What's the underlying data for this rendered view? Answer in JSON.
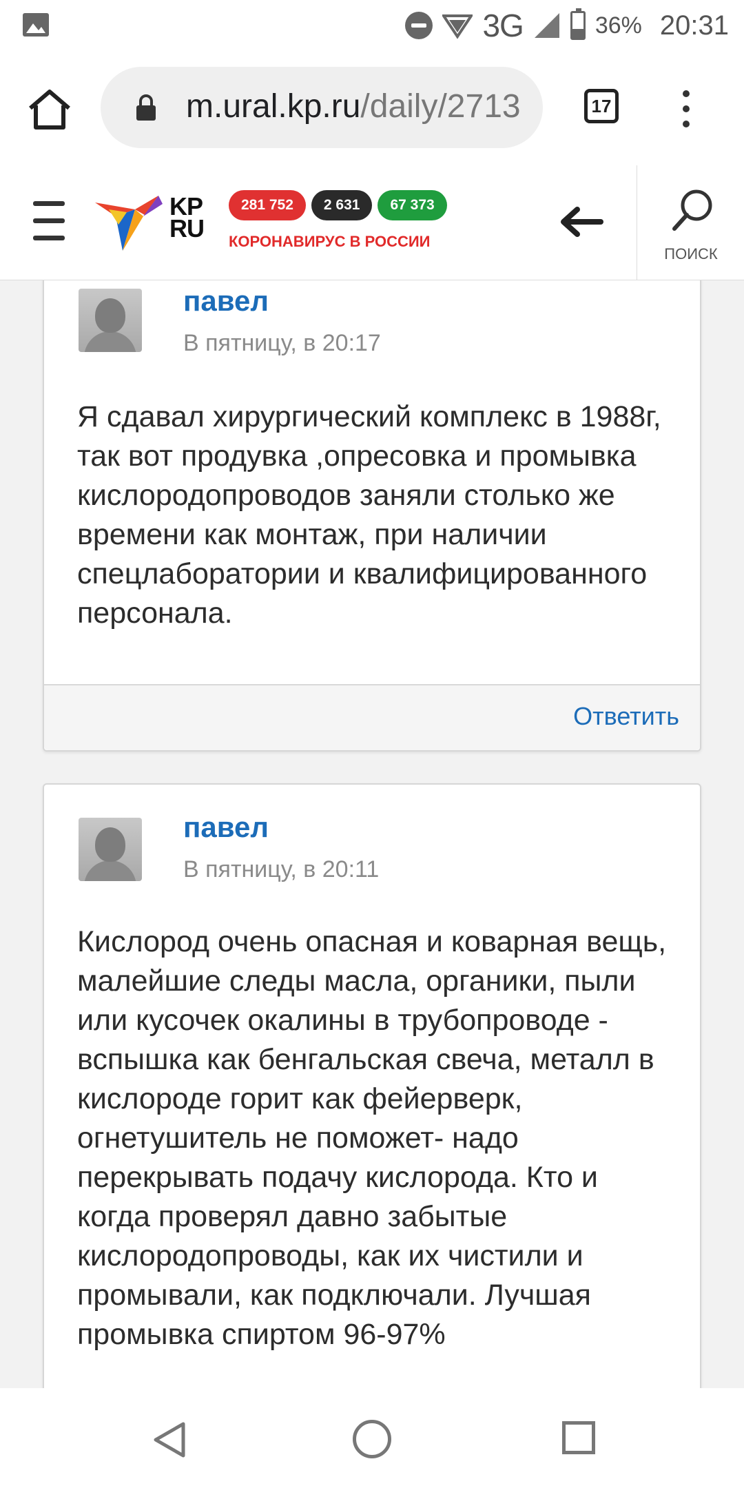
{
  "status_bar": {
    "network": "3G",
    "battery_percent": "36%",
    "battery_level": 0.36,
    "time": "20:31"
  },
  "browser": {
    "url_host": "m.ural.kp.ru",
    "url_path": "/daily/2713",
    "tab_count": "17"
  },
  "site_header": {
    "logo_text_top": "KP",
    "logo_text_bottom": "RU",
    "stats": {
      "cases": "281 752",
      "deaths": "2 631",
      "recovered": "67 373"
    },
    "covid_label": "КОРОНАВИРУС В РОССИИ",
    "search_label": "ПОИСК"
  },
  "comments": [
    {
      "author": "павел",
      "date": "В пятницу, в 20:17",
      "text": "Я сдавал хирургический комплекс в 1988г, так вот продувка ,опресовка и промывка кислородопроводов заняли столько же времени как монтаж, при наличии спецлаборатории и квалифицированного персонала.",
      "reply_label": "Ответить"
    },
    {
      "author": "павел",
      "date": "В пятницу, в 20:11",
      "text": "Кислород очень опасная и коварная вещь, малейшие следы масла, органики, пыли или кусочек окалины в трубопроводе - вспышка как бенгальская свеча, металл в кислороде горит как фейерверк, огнетушитель не поможет- надо перекрывать подачу кислорода. Кто и когда проверял давно забытые кислородопроводы, как их чистили и промывали, как подключали. Лучшая промывка спиртом 96-97%"
    }
  ],
  "colors": {
    "link_blue": "#1c6cb8",
    "badge_red": "#e03131",
    "badge_dark": "#2a2a2a",
    "badge_green": "#1f9d3e",
    "covid_red": "#e12a2a"
  }
}
